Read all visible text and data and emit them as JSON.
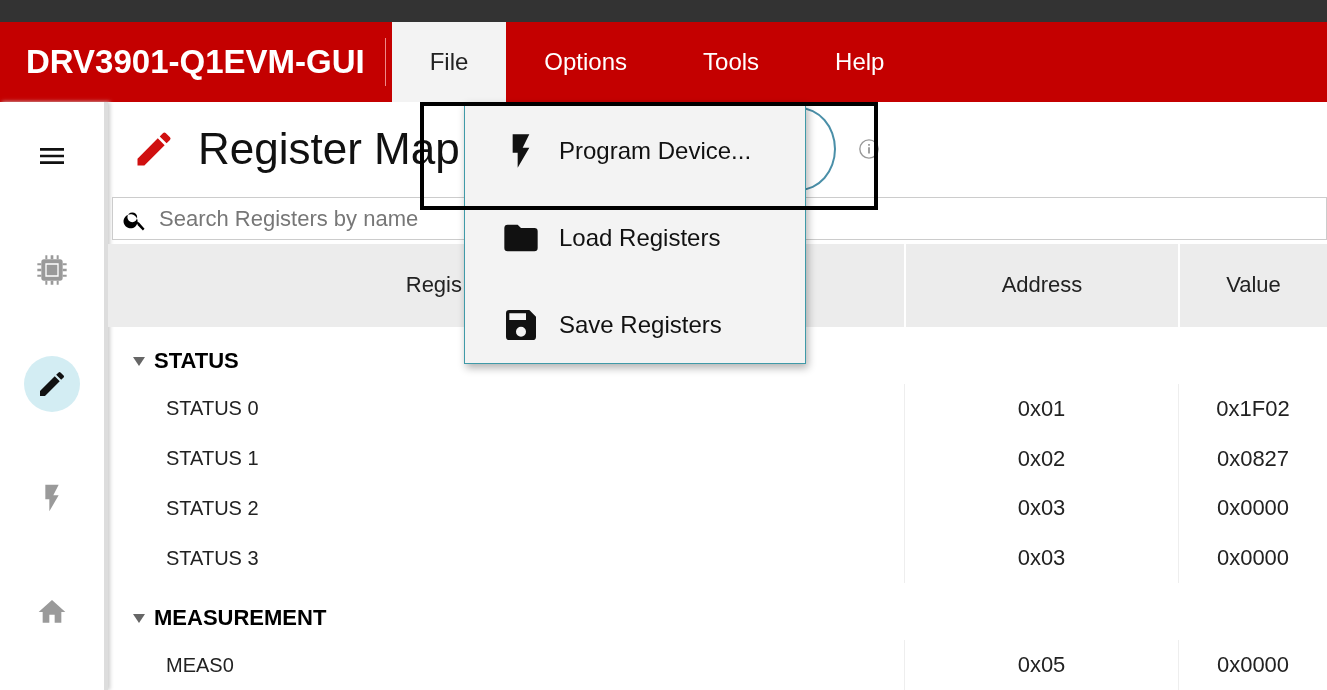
{
  "app_title": "DRV3901-Q1EVM-GUI",
  "menu_bar": [
    {
      "label": "File",
      "selected": true
    },
    {
      "label": "Options",
      "selected": false
    },
    {
      "label": "Tools",
      "selected": false
    },
    {
      "label": "Help",
      "selected": false
    }
  ],
  "file_menu": [
    {
      "kind": "program",
      "label": "Program Device...",
      "highlighted": true
    },
    {
      "kind": "load",
      "label": "Load Registers",
      "highlighted": false
    },
    {
      "kind": "save",
      "label": "Save Registers",
      "highlighted": false
    }
  ],
  "sidebar": [
    {
      "kind": "menu",
      "selected": false
    },
    {
      "kind": "chip",
      "selected": false
    },
    {
      "kind": "edit",
      "selected": true
    },
    {
      "kind": "flash",
      "selected": false
    },
    {
      "kind": "home",
      "selected": false
    }
  ],
  "page_title": "Register Map",
  "search": {
    "placeholder": "Search Registers by name"
  },
  "table": {
    "columns": [
      "Regis",
      "Address",
      "Value"
    ],
    "groups": [
      {
        "name": "STATUS",
        "expanded": true,
        "rows": [
          {
            "name": "STATUS 0",
            "address": "0x01",
            "value": "0x1F02"
          },
          {
            "name": "STATUS 1",
            "address": "0x02",
            "value": "0x0827"
          },
          {
            "name": "STATUS 2",
            "address": "0x03",
            "value": "0x0000"
          },
          {
            "name": "STATUS 3",
            "address": "0x03",
            "value": "0x0000"
          }
        ]
      },
      {
        "name": "MEASUREMENT",
        "expanded": true,
        "rows": [
          {
            "name": "MEAS0",
            "address": "0x05",
            "value": "0x0000"
          }
        ]
      }
    ]
  }
}
